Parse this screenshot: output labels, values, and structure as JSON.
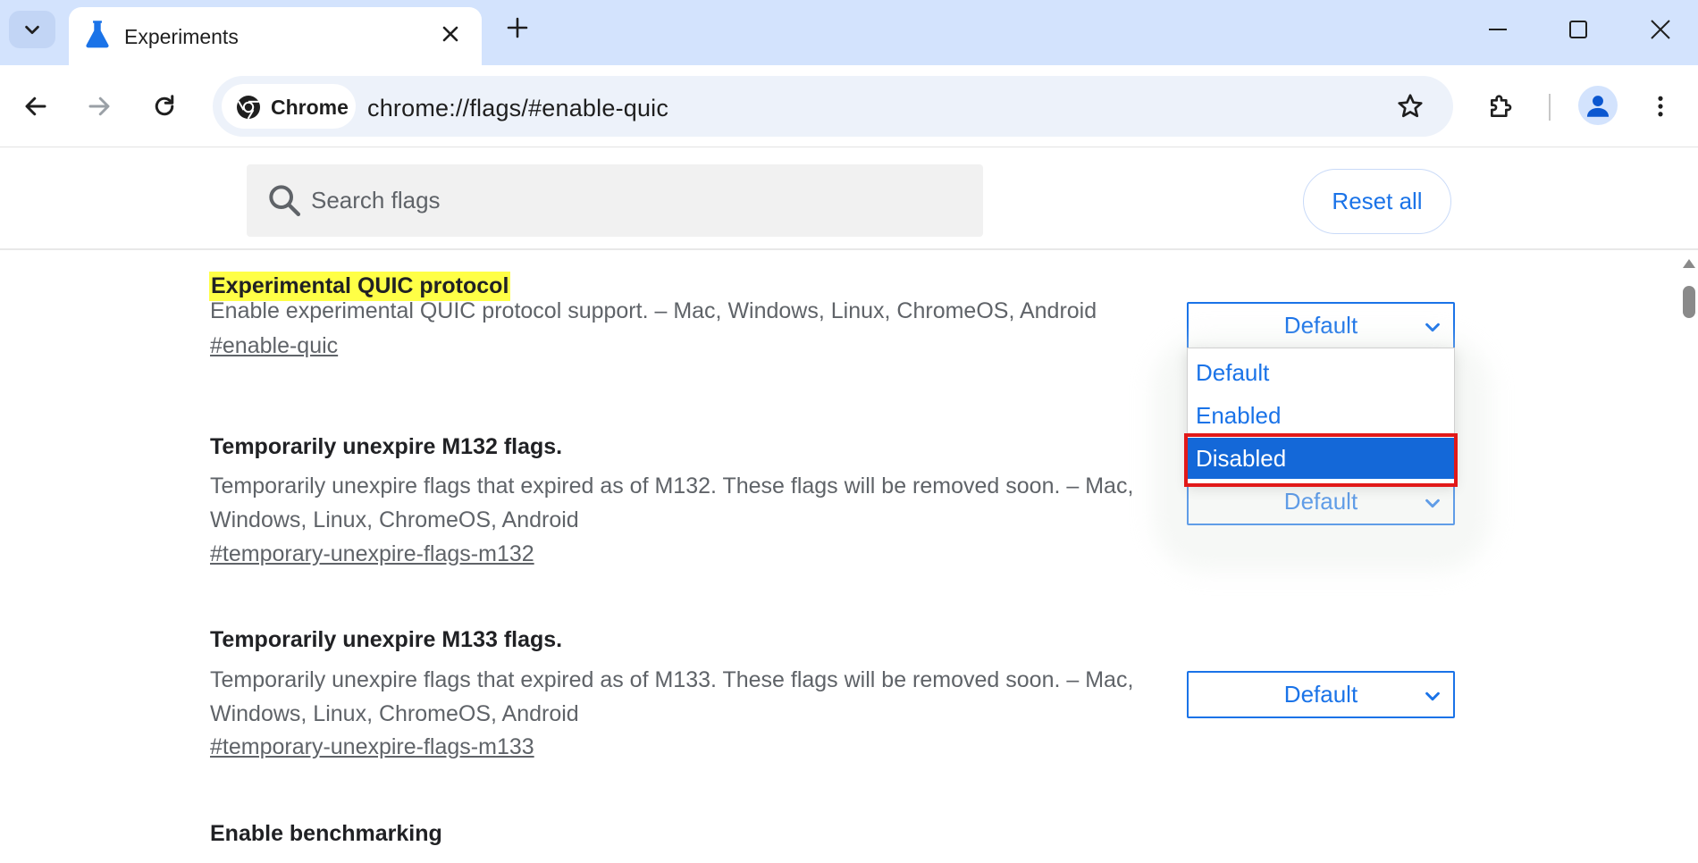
{
  "tab": {
    "title": "Experiments"
  },
  "omnibox": {
    "chip_label": "Chrome",
    "url": "chrome://flags/#enable-quic"
  },
  "header": {
    "search_placeholder": "Search flags",
    "reset_label": "Reset all"
  },
  "flags": [
    {
      "title": "Experimental QUIC protocol",
      "desc": "Enable experimental QUIC protocol support. – Mac, Windows, Linux, ChromeOS, Android",
      "link": "#enable-quic",
      "value": "Default"
    },
    {
      "title": "Temporarily unexpire M132 flags.",
      "desc": "Temporarily unexpire flags that expired as of M132. These flags will be removed soon. – Mac, Windows, Linux, ChromeOS, Android",
      "link": "#temporary-unexpire-flags-m132",
      "value": "Default"
    },
    {
      "title": "Temporarily unexpire M133 flags.",
      "desc": "Temporarily unexpire flags that expired as of M133. These flags will be removed soon. – Mac, Windows, Linux, ChromeOS, Android",
      "link": "#temporary-unexpire-flags-m133",
      "value": "Default"
    },
    {
      "title": "Enable benchmarking"
    }
  ],
  "dropdown": {
    "options": [
      "Default",
      "Enabled",
      "Disabled"
    ],
    "highlighted": "Disabled"
  },
  "colors": {
    "accent": "#1a73e8",
    "highlight": "#ffff46",
    "selected_option": "#1468d8",
    "annotation_outline": "#e11919",
    "tabstrip": "#d3e3fd"
  },
  "icons": {
    "tab_search": "chevron-down-icon",
    "favicon": "flask-icon",
    "close": "close-icon",
    "new_tab": "plus-icon",
    "back": "arrow-left-icon",
    "forward": "arrow-right-icon",
    "reload": "reload-icon",
    "chrome": "chrome-logo-icon",
    "bookmark": "star-icon",
    "extensions": "puzzle-icon",
    "profile": "person-icon",
    "menu": "kebab-menu-icon",
    "search": "search-icon"
  }
}
